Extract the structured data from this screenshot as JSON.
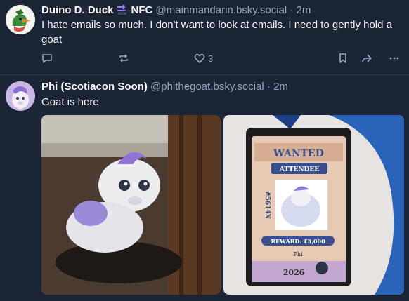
{
  "post1": {
    "display_name": "Duino D. Duck",
    "badge_icon": "soon-arrow-icon",
    "badge_text": "NFC",
    "handle": "@mainmandarin.bsky.social",
    "separator": "·",
    "time": "2m",
    "text": "I hate emails so much. I don't want to look at emails. I need to gently hold a goat",
    "like_count": "3"
  },
  "post2": {
    "display_name": "Phi (Scotiacon Soon)",
    "handle": "@phithegoat.bsky.social",
    "separator": "·",
    "time": "2m",
    "text": "Goat is here",
    "badge": {
      "wanted": "WANTED",
      "attendee": "ATTENDEE",
      "number": "#5614X",
      "reward": "REWARD: £3,000",
      "name": "Phi",
      "year": "2026"
    }
  },
  "colors": {
    "background": "#1b2535",
    "text": "#f1f3f5",
    "muted": "#93a5bb",
    "accent": "#208bfe"
  }
}
